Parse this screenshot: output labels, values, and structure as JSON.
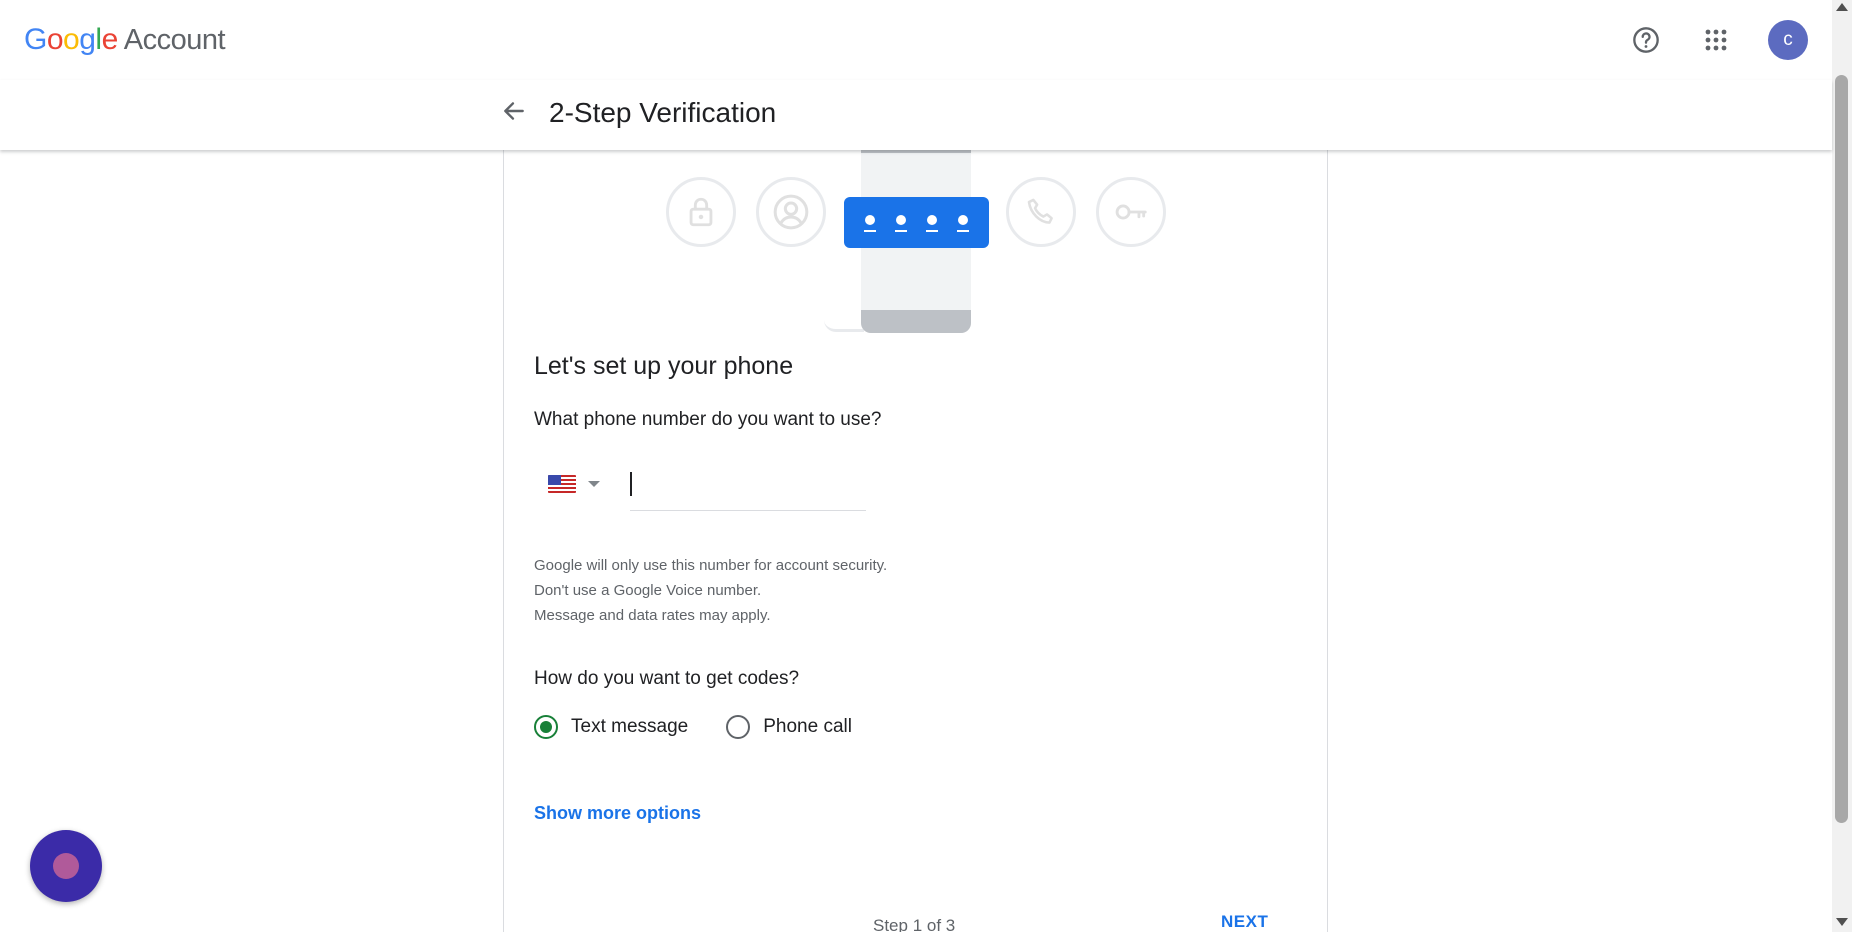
{
  "header": {
    "brand_google": [
      "G",
      "o",
      "o",
      "g",
      "l",
      "e"
    ],
    "brand_colors": [
      "#4285F4",
      "#EA4335",
      "#FBBC05",
      "#4285F4",
      "#34A853",
      "#EA4335"
    ],
    "brand_product": "Account",
    "help_icon": "help-circle-icon",
    "apps_icon": "apps-grid-icon",
    "avatar_letter": "c",
    "avatar_color": "#5c6bc0"
  },
  "subheader": {
    "back_icon": "arrow-back-icon",
    "title": "2-Step Verification"
  },
  "illustration": {
    "icons": [
      "lock-icon",
      "account-circle-icon",
      "code-dots-icon",
      "phone-icon",
      "key-icon"
    ],
    "accent": "#1a73e8"
  },
  "setup": {
    "heading": "Let's set up your phone",
    "number_question": "What phone number do you want to use?",
    "country": "us-flag-icon",
    "phone_value": "",
    "hint_lines": [
      "Google will only use this number for account security.",
      "Don't use a Google Voice number.",
      "Message and data rates may apply."
    ],
    "codes_question": "How do you want to get codes?",
    "options": [
      {
        "label": "Text message",
        "selected": true
      },
      {
        "label": "Phone call",
        "selected": false
      }
    ],
    "selected_color": "#188038",
    "more_options": "Show more options"
  },
  "footer": {
    "step_text": "Step 1 of 3",
    "next_label": "NEXT"
  }
}
